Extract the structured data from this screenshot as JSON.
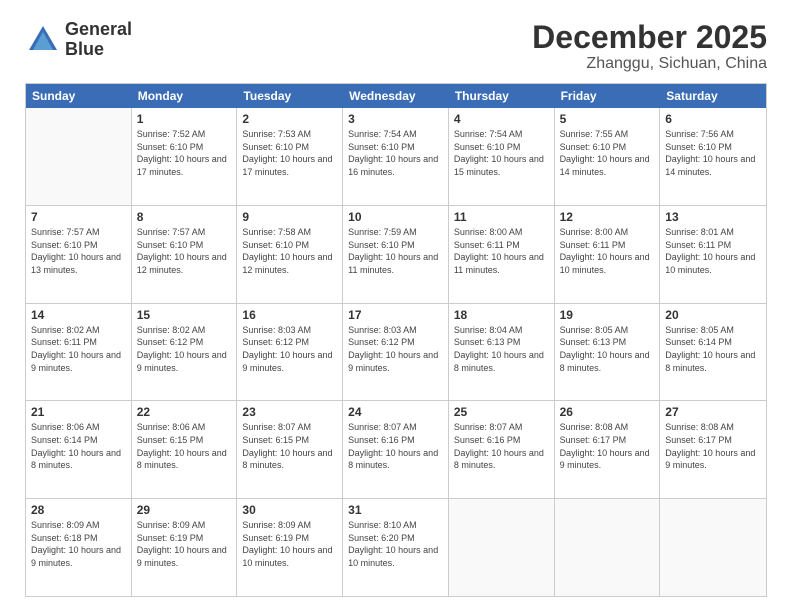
{
  "logo": {
    "line1": "General",
    "line2": "Blue"
  },
  "title": "December 2025",
  "subtitle": "Zhanggu, Sichuan, China",
  "days": [
    "Sunday",
    "Monday",
    "Tuesday",
    "Wednesday",
    "Thursday",
    "Friday",
    "Saturday"
  ],
  "rows": [
    [
      {
        "day": "",
        "empty": true
      },
      {
        "day": "1",
        "sunrise": "Sunrise: 7:52 AM",
        "sunset": "Sunset: 6:10 PM",
        "daylight": "Daylight: 10 hours and 17 minutes."
      },
      {
        "day": "2",
        "sunrise": "Sunrise: 7:53 AM",
        "sunset": "Sunset: 6:10 PM",
        "daylight": "Daylight: 10 hours and 17 minutes."
      },
      {
        "day": "3",
        "sunrise": "Sunrise: 7:54 AM",
        "sunset": "Sunset: 6:10 PM",
        "daylight": "Daylight: 10 hours and 16 minutes."
      },
      {
        "day": "4",
        "sunrise": "Sunrise: 7:54 AM",
        "sunset": "Sunset: 6:10 PM",
        "daylight": "Daylight: 10 hours and 15 minutes."
      },
      {
        "day": "5",
        "sunrise": "Sunrise: 7:55 AM",
        "sunset": "Sunset: 6:10 PM",
        "daylight": "Daylight: 10 hours and 14 minutes."
      },
      {
        "day": "6",
        "sunrise": "Sunrise: 7:56 AM",
        "sunset": "Sunset: 6:10 PM",
        "daylight": "Daylight: 10 hours and 14 minutes."
      }
    ],
    [
      {
        "day": "7",
        "sunrise": "Sunrise: 7:57 AM",
        "sunset": "Sunset: 6:10 PM",
        "daylight": "Daylight: 10 hours and 13 minutes."
      },
      {
        "day": "8",
        "sunrise": "Sunrise: 7:57 AM",
        "sunset": "Sunset: 6:10 PM",
        "daylight": "Daylight: 10 hours and 12 minutes."
      },
      {
        "day": "9",
        "sunrise": "Sunrise: 7:58 AM",
        "sunset": "Sunset: 6:10 PM",
        "daylight": "Daylight: 10 hours and 12 minutes."
      },
      {
        "day": "10",
        "sunrise": "Sunrise: 7:59 AM",
        "sunset": "Sunset: 6:10 PM",
        "daylight": "Daylight: 10 hours and 11 minutes."
      },
      {
        "day": "11",
        "sunrise": "Sunrise: 8:00 AM",
        "sunset": "Sunset: 6:11 PM",
        "daylight": "Daylight: 10 hours and 11 minutes."
      },
      {
        "day": "12",
        "sunrise": "Sunrise: 8:00 AM",
        "sunset": "Sunset: 6:11 PM",
        "daylight": "Daylight: 10 hours and 10 minutes."
      },
      {
        "day": "13",
        "sunrise": "Sunrise: 8:01 AM",
        "sunset": "Sunset: 6:11 PM",
        "daylight": "Daylight: 10 hours and 10 minutes."
      }
    ],
    [
      {
        "day": "14",
        "sunrise": "Sunrise: 8:02 AM",
        "sunset": "Sunset: 6:11 PM",
        "daylight": "Daylight: 10 hours and 9 minutes."
      },
      {
        "day": "15",
        "sunrise": "Sunrise: 8:02 AM",
        "sunset": "Sunset: 6:12 PM",
        "daylight": "Daylight: 10 hours and 9 minutes."
      },
      {
        "day": "16",
        "sunrise": "Sunrise: 8:03 AM",
        "sunset": "Sunset: 6:12 PM",
        "daylight": "Daylight: 10 hours and 9 minutes."
      },
      {
        "day": "17",
        "sunrise": "Sunrise: 8:03 AM",
        "sunset": "Sunset: 6:12 PM",
        "daylight": "Daylight: 10 hours and 9 minutes."
      },
      {
        "day": "18",
        "sunrise": "Sunrise: 8:04 AM",
        "sunset": "Sunset: 6:13 PM",
        "daylight": "Daylight: 10 hours and 8 minutes."
      },
      {
        "day": "19",
        "sunrise": "Sunrise: 8:05 AM",
        "sunset": "Sunset: 6:13 PM",
        "daylight": "Daylight: 10 hours and 8 minutes."
      },
      {
        "day": "20",
        "sunrise": "Sunrise: 8:05 AM",
        "sunset": "Sunset: 6:14 PM",
        "daylight": "Daylight: 10 hours and 8 minutes."
      }
    ],
    [
      {
        "day": "21",
        "sunrise": "Sunrise: 8:06 AM",
        "sunset": "Sunset: 6:14 PM",
        "daylight": "Daylight: 10 hours and 8 minutes."
      },
      {
        "day": "22",
        "sunrise": "Sunrise: 8:06 AM",
        "sunset": "Sunset: 6:15 PM",
        "daylight": "Daylight: 10 hours and 8 minutes."
      },
      {
        "day": "23",
        "sunrise": "Sunrise: 8:07 AM",
        "sunset": "Sunset: 6:15 PM",
        "daylight": "Daylight: 10 hours and 8 minutes."
      },
      {
        "day": "24",
        "sunrise": "Sunrise: 8:07 AM",
        "sunset": "Sunset: 6:16 PM",
        "daylight": "Daylight: 10 hours and 8 minutes."
      },
      {
        "day": "25",
        "sunrise": "Sunrise: 8:07 AM",
        "sunset": "Sunset: 6:16 PM",
        "daylight": "Daylight: 10 hours and 8 minutes."
      },
      {
        "day": "26",
        "sunrise": "Sunrise: 8:08 AM",
        "sunset": "Sunset: 6:17 PM",
        "daylight": "Daylight: 10 hours and 9 minutes."
      },
      {
        "day": "27",
        "sunrise": "Sunrise: 8:08 AM",
        "sunset": "Sunset: 6:17 PM",
        "daylight": "Daylight: 10 hours and 9 minutes."
      }
    ],
    [
      {
        "day": "28",
        "sunrise": "Sunrise: 8:09 AM",
        "sunset": "Sunset: 6:18 PM",
        "daylight": "Daylight: 10 hours and 9 minutes."
      },
      {
        "day": "29",
        "sunrise": "Sunrise: 8:09 AM",
        "sunset": "Sunset: 6:19 PM",
        "daylight": "Daylight: 10 hours and 9 minutes."
      },
      {
        "day": "30",
        "sunrise": "Sunrise: 8:09 AM",
        "sunset": "Sunset: 6:19 PM",
        "daylight": "Daylight: 10 hours and 10 minutes."
      },
      {
        "day": "31",
        "sunrise": "Sunrise: 8:10 AM",
        "sunset": "Sunset: 6:20 PM",
        "daylight": "Daylight: 10 hours and 10 minutes."
      },
      {
        "day": "",
        "empty": true
      },
      {
        "day": "",
        "empty": true
      },
      {
        "day": "",
        "empty": true
      }
    ]
  ]
}
